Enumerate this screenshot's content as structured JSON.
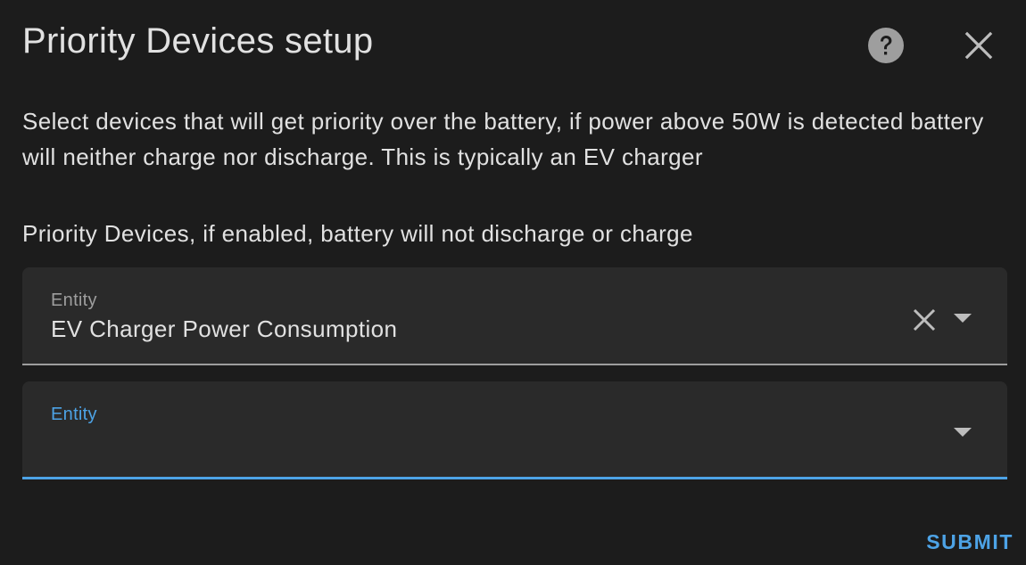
{
  "dialog": {
    "title": "Priority Devices setup",
    "description": "Select devices that will get priority over the battery, if power above 50W is detected battery will neither charge nor discharge. This is typically an EV charger",
    "section_label": "Priority Devices, if enabled, battery will not discharge or charge",
    "icons": {
      "help": "help-circle-icon",
      "close": "close-icon"
    }
  },
  "fields": [
    {
      "label": "Entity",
      "value": "EV Charger Power Consumption",
      "icons": [
        "clear-icon",
        "chevron-down-icon"
      ]
    },
    {
      "label": "Entity",
      "value": "",
      "focused": true,
      "icons": [
        "chevron-down-icon"
      ]
    }
  ],
  "actions": {
    "submit_label": "SUBMIT"
  },
  "colors": {
    "background": "#1c1c1c",
    "field_background": "#2a2a2a",
    "accent": "#4da3e6",
    "text": "#e1e1e1",
    "muted": "#9e9e9e"
  }
}
